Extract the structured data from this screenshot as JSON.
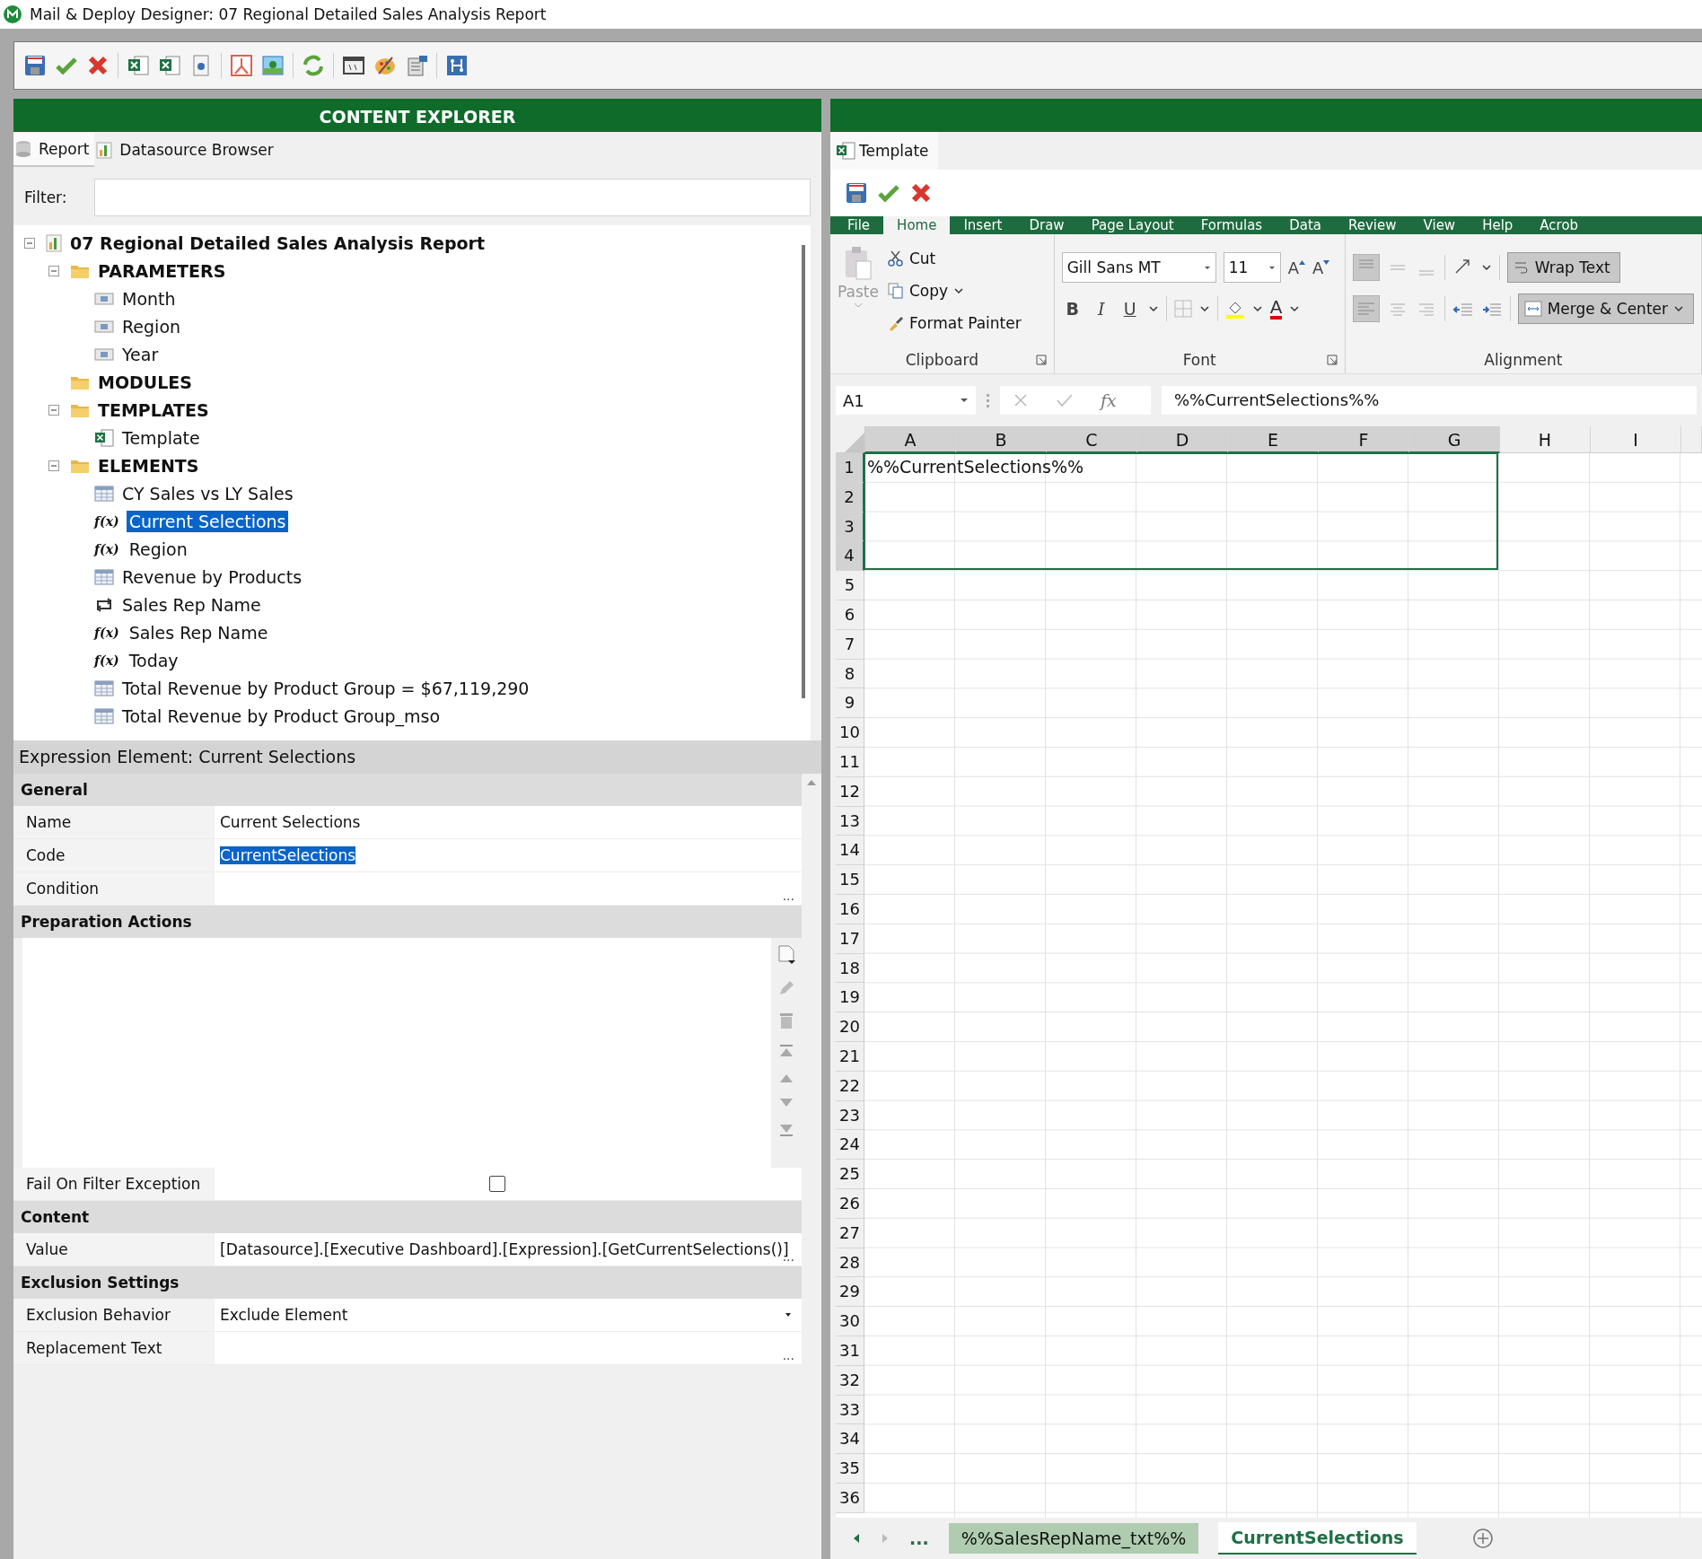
{
  "window": {
    "title": "Mail & Deploy Designer: 07 Regional Detailed Sales Analysis Report"
  },
  "content_explorer": {
    "title": "CONTENT EXPLORER",
    "tabs": [
      {
        "label": "Report",
        "kind": "report",
        "selected": true
      },
      {
        "label": "Datasource Browser",
        "kind": "datasource",
        "selected": false
      }
    ],
    "filter": {
      "label": "Filter:"
    },
    "tree": [
      {
        "label": "07 Regional Detailed Sales Analysis Report",
        "kind": "report",
        "bold": true,
        "expanded": true,
        "selected": false,
        "children": [
          {
            "label": "PARAMETERS",
            "kind": "folder",
            "bold": true,
            "expanded": true,
            "selected": false,
            "children": [
              {
                "label": "Month",
                "kind": "parameter",
                "selected": false
              },
              {
                "label": "Region",
                "kind": "parameter",
                "selected": false
              },
              {
                "label": "Year",
                "kind": "parameter",
                "selected": false
              }
            ]
          },
          {
            "label": "MODULES",
            "kind": "folder",
            "bold": true,
            "selected": false
          },
          {
            "label": "TEMPLATES",
            "kind": "folder",
            "bold": true,
            "expanded": true,
            "selected": false,
            "children": [
              {
                "label": "Template",
                "kind": "excel",
                "selected": false
              }
            ]
          },
          {
            "label": "ELEMENTS",
            "kind": "folder",
            "bold": true,
            "expanded": true,
            "selected": false,
            "children": [
              {
                "label": "CY Sales vs LY Sales",
                "kind": "table",
                "selected": false
              },
              {
                "label": "Current Selections",
                "kind": "expression",
                "glyph": "f(x)",
                "selected": true
              },
              {
                "label": "Region",
                "kind": "expression",
                "glyph": "f(x)",
                "selected": false
              },
              {
                "label": "Revenue by Products",
                "kind": "table",
                "selected": false
              },
              {
                "label": "Sales Rep Name",
                "kind": "pivot",
                "selected": false
              },
              {
                "label": "Sales Rep Name",
                "kind": "expression",
                "glyph": "f(x)",
                "selected": false
              },
              {
                "label": "Today",
                "kind": "expression",
                "glyph": "f(x)",
                "selected": false
              },
              {
                "label": "Total Revenue by Product Group = $67,119,290",
                "kind": "table",
                "selected": false
              },
              {
                "label": "Total Revenue by Product Group_mso",
                "kind": "table",
                "selected": false
              }
            ]
          }
        ]
      }
    ]
  },
  "properties": {
    "title": "Expression Element: Current Selections",
    "sections": [
      {
        "title": "General",
        "rows": [
          {
            "kind": "text",
            "label": "Name",
            "value": "Current Selections"
          },
          {
            "kind": "text",
            "label": "Code",
            "value": "CurrentSelections",
            "highlighted": true
          },
          {
            "kind": "ellipsis",
            "label": "Condition",
            "button": "..."
          }
        ]
      },
      {
        "title": "Preparation Actions",
        "rows": [
          {
            "kind": "list"
          },
          {
            "kind": "checkbox",
            "label": "Fail On Filter Exception",
            "checked": false
          }
        ]
      },
      {
        "title": "Content",
        "rows": [
          {
            "kind": "ellipsis",
            "label": "Value",
            "value": "[Datasource].[Executive Dashboard].[Expression].[GetCurrentSelections()]",
            "button": "..."
          }
        ]
      },
      {
        "title": "Exclusion Settings",
        "rows": [
          {
            "kind": "dropdown",
            "label": "Exclusion Behavior",
            "value": "Exclude Element"
          },
          {
            "kind": "ellipsis",
            "label": "Replacement Text",
            "button": "..."
          }
        ]
      }
    ]
  },
  "template": {
    "tab": "Template",
    "ribbon_tabs": [
      {
        "label": "File",
        "selected": false
      },
      {
        "label": "Home",
        "selected": true
      },
      {
        "label": "Insert",
        "selected": false
      },
      {
        "label": "Draw",
        "selected": false
      },
      {
        "label": "Page Layout",
        "selected": false
      },
      {
        "label": "Formulas",
        "selected": false
      },
      {
        "label": "Data",
        "selected": false
      },
      {
        "label": "Review",
        "selected": false
      },
      {
        "label": "View",
        "selected": false
      },
      {
        "label": "Help",
        "selected": false
      },
      {
        "label": "Acrob",
        "selected": false
      }
    ],
    "clipboard": {
      "paste": "Paste",
      "cut": "Cut",
      "copy": "Copy",
      "format_painter": "Format Painter",
      "group": "Clipboard"
    },
    "font": {
      "name": "Gill Sans MT",
      "size": "11",
      "bold": "B",
      "italic": "I",
      "underline": "U",
      "grow": "A",
      "shrink": "A",
      "color_letter": "A",
      "group": "Font"
    },
    "alignment": {
      "wrap": "Wrap Text",
      "merge": "Merge & Center",
      "group": "Alignment"
    },
    "name_box": "A1",
    "fx": "fx",
    "formula": "%%CurrentSelections%%",
    "columns": [
      {
        "label": "A",
        "selected": true
      },
      {
        "label": "B",
        "selected": true
      },
      {
        "label": "C",
        "selected": true
      },
      {
        "label": "D",
        "selected": true
      },
      {
        "label": "E",
        "selected": true
      },
      {
        "label": "F",
        "selected": true
      },
      {
        "label": "G",
        "selected": true
      },
      {
        "label": "H",
        "selected": false
      },
      {
        "label": "I",
        "selected": false
      }
    ],
    "rows": [
      {
        "label": "1",
        "selected": true
      },
      {
        "label": "2",
        "selected": true
      },
      {
        "label": "3",
        "selected": true
      },
      {
        "label": "4",
        "selected": true
      },
      {
        "label": "5",
        "selected": false
      },
      {
        "label": "6",
        "selected": false
      },
      {
        "label": "7",
        "selected": false
      },
      {
        "label": "8",
        "selected": false
      },
      {
        "label": "9",
        "selected": false
      },
      {
        "label": "10",
        "selected": false
      },
      {
        "label": "11",
        "selected": false
      },
      {
        "label": "12",
        "selected": false
      },
      {
        "label": "13",
        "selected": false
      },
      {
        "label": "14",
        "selected": false
      },
      {
        "label": "15",
        "selected": false
      },
      {
        "label": "16",
        "selected": false
      },
      {
        "label": "17",
        "selected": false
      },
      {
        "label": "18",
        "selected": false
      },
      {
        "label": "19",
        "selected": false
      },
      {
        "label": "20",
        "selected": false
      },
      {
        "label": "21",
        "selected": false
      },
      {
        "label": "22",
        "selected": false
      },
      {
        "label": "23",
        "selected": false
      },
      {
        "label": "24",
        "selected": false
      },
      {
        "label": "25",
        "selected": false
      },
      {
        "label": "26",
        "selected": false
      },
      {
        "label": "27",
        "selected": false
      },
      {
        "label": "28",
        "selected": false
      },
      {
        "label": "29",
        "selected": false
      },
      {
        "label": "30",
        "selected": false
      },
      {
        "label": "31",
        "selected": false
      },
      {
        "label": "32",
        "selected": false
      },
      {
        "label": "33",
        "selected": false
      },
      {
        "label": "34",
        "selected": false
      },
      {
        "label": "35",
        "selected": false
      },
      {
        "label": "36",
        "selected": false
      }
    ],
    "cell_a1": "%%CurrentSelections%%",
    "sheet_more": "...",
    "sheets": [
      {
        "label": "%%SalesRepName_txt%%",
        "selected": false
      },
      {
        "label": "CurrentSelections",
        "selected": true
      }
    ]
  }
}
